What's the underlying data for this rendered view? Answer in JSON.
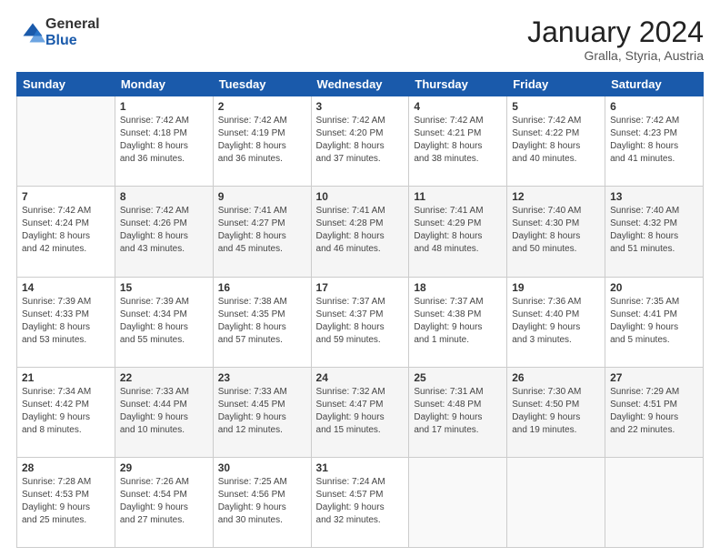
{
  "header": {
    "logo_general": "General",
    "logo_blue": "Blue",
    "main_title": "January 2024",
    "subtitle": "Gralla, Styria, Austria"
  },
  "days_of_week": [
    "Sunday",
    "Monday",
    "Tuesday",
    "Wednesday",
    "Thursday",
    "Friday",
    "Saturday"
  ],
  "weeks": [
    [
      {
        "day": "",
        "info": ""
      },
      {
        "day": "1",
        "info": "Sunrise: 7:42 AM\nSunset: 4:18 PM\nDaylight: 8 hours\nand 36 minutes."
      },
      {
        "day": "2",
        "info": "Sunrise: 7:42 AM\nSunset: 4:19 PM\nDaylight: 8 hours\nand 36 minutes."
      },
      {
        "day": "3",
        "info": "Sunrise: 7:42 AM\nSunset: 4:20 PM\nDaylight: 8 hours\nand 37 minutes."
      },
      {
        "day": "4",
        "info": "Sunrise: 7:42 AM\nSunset: 4:21 PM\nDaylight: 8 hours\nand 38 minutes."
      },
      {
        "day": "5",
        "info": "Sunrise: 7:42 AM\nSunset: 4:22 PM\nDaylight: 8 hours\nand 40 minutes."
      },
      {
        "day": "6",
        "info": "Sunrise: 7:42 AM\nSunset: 4:23 PM\nDaylight: 8 hours\nand 41 minutes."
      }
    ],
    [
      {
        "day": "7",
        "info": "Sunrise: 7:42 AM\nSunset: 4:24 PM\nDaylight: 8 hours\nand 42 minutes."
      },
      {
        "day": "8",
        "info": "Sunrise: 7:42 AM\nSunset: 4:26 PM\nDaylight: 8 hours\nand 43 minutes."
      },
      {
        "day": "9",
        "info": "Sunrise: 7:41 AM\nSunset: 4:27 PM\nDaylight: 8 hours\nand 45 minutes."
      },
      {
        "day": "10",
        "info": "Sunrise: 7:41 AM\nSunset: 4:28 PM\nDaylight: 8 hours\nand 46 minutes."
      },
      {
        "day": "11",
        "info": "Sunrise: 7:41 AM\nSunset: 4:29 PM\nDaylight: 8 hours\nand 48 minutes."
      },
      {
        "day": "12",
        "info": "Sunrise: 7:40 AM\nSunset: 4:30 PM\nDaylight: 8 hours\nand 50 minutes."
      },
      {
        "day": "13",
        "info": "Sunrise: 7:40 AM\nSunset: 4:32 PM\nDaylight: 8 hours\nand 51 minutes."
      }
    ],
    [
      {
        "day": "14",
        "info": "Sunrise: 7:39 AM\nSunset: 4:33 PM\nDaylight: 8 hours\nand 53 minutes."
      },
      {
        "day": "15",
        "info": "Sunrise: 7:39 AM\nSunset: 4:34 PM\nDaylight: 8 hours\nand 55 minutes."
      },
      {
        "day": "16",
        "info": "Sunrise: 7:38 AM\nSunset: 4:35 PM\nDaylight: 8 hours\nand 57 minutes."
      },
      {
        "day": "17",
        "info": "Sunrise: 7:37 AM\nSunset: 4:37 PM\nDaylight: 8 hours\nand 59 minutes."
      },
      {
        "day": "18",
        "info": "Sunrise: 7:37 AM\nSunset: 4:38 PM\nDaylight: 9 hours\nand 1 minute."
      },
      {
        "day": "19",
        "info": "Sunrise: 7:36 AM\nSunset: 4:40 PM\nDaylight: 9 hours\nand 3 minutes."
      },
      {
        "day": "20",
        "info": "Sunrise: 7:35 AM\nSunset: 4:41 PM\nDaylight: 9 hours\nand 5 minutes."
      }
    ],
    [
      {
        "day": "21",
        "info": "Sunrise: 7:34 AM\nSunset: 4:42 PM\nDaylight: 9 hours\nand 8 minutes."
      },
      {
        "day": "22",
        "info": "Sunrise: 7:33 AM\nSunset: 4:44 PM\nDaylight: 9 hours\nand 10 minutes."
      },
      {
        "day": "23",
        "info": "Sunrise: 7:33 AM\nSunset: 4:45 PM\nDaylight: 9 hours\nand 12 minutes."
      },
      {
        "day": "24",
        "info": "Sunrise: 7:32 AM\nSunset: 4:47 PM\nDaylight: 9 hours\nand 15 minutes."
      },
      {
        "day": "25",
        "info": "Sunrise: 7:31 AM\nSunset: 4:48 PM\nDaylight: 9 hours\nand 17 minutes."
      },
      {
        "day": "26",
        "info": "Sunrise: 7:30 AM\nSunset: 4:50 PM\nDaylight: 9 hours\nand 19 minutes."
      },
      {
        "day": "27",
        "info": "Sunrise: 7:29 AM\nSunset: 4:51 PM\nDaylight: 9 hours\nand 22 minutes."
      }
    ],
    [
      {
        "day": "28",
        "info": "Sunrise: 7:28 AM\nSunset: 4:53 PM\nDaylight: 9 hours\nand 25 minutes."
      },
      {
        "day": "29",
        "info": "Sunrise: 7:26 AM\nSunset: 4:54 PM\nDaylight: 9 hours\nand 27 minutes."
      },
      {
        "day": "30",
        "info": "Sunrise: 7:25 AM\nSunset: 4:56 PM\nDaylight: 9 hours\nand 30 minutes."
      },
      {
        "day": "31",
        "info": "Sunrise: 7:24 AM\nSunset: 4:57 PM\nDaylight: 9 hours\nand 32 minutes."
      },
      {
        "day": "",
        "info": ""
      },
      {
        "day": "",
        "info": ""
      },
      {
        "day": "",
        "info": ""
      }
    ]
  ]
}
